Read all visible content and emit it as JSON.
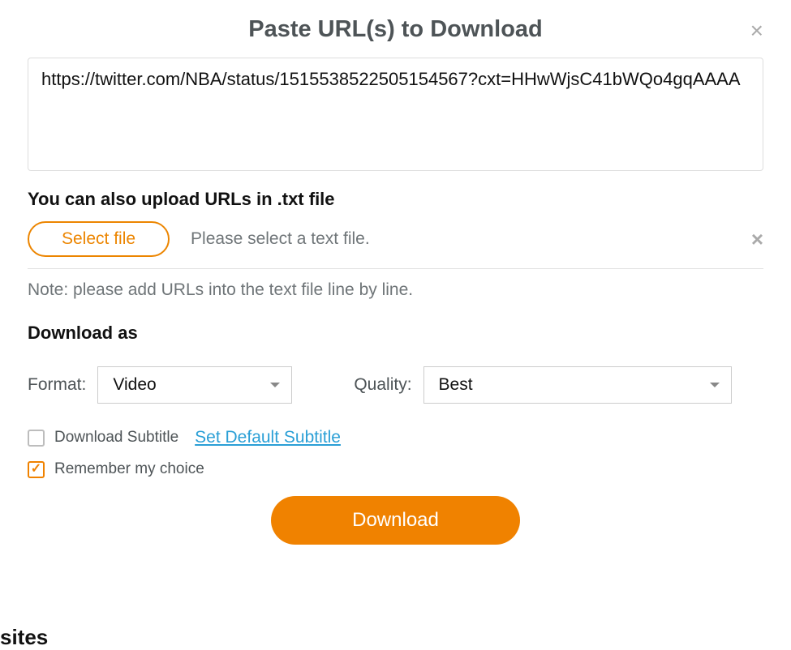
{
  "dialog": {
    "title": "Paste URL(s) to Download",
    "close_icon": "×",
    "url_value": "https://twitter.com/NBA/status/1515538522505154567?cxt=HHwWjsC41bWQo4gqAAAA",
    "upload_title": "You can also upload URLs in .txt file",
    "select_file_label": "Select file",
    "file_status": "Please select a text file.",
    "clear_file_icon": "×",
    "note": "Note: please add URLs into the text file line by line.",
    "download_as_title": "Download as",
    "format_label": "Format:",
    "format_value": "Video",
    "quality_label": "Quality:",
    "quality_value": "Best",
    "subtitle_checkbox_label": "Download Subtitle",
    "subtitle_checkbox_checked": false,
    "set_default_subtitle_label": "Set Default Subtitle",
    "remember_checkbox_label": "Remember my choice",
    "remember_checkbox_checked": true,
    "download_button_label": "Download",
    "trailing_text": "sites"
  }
}
